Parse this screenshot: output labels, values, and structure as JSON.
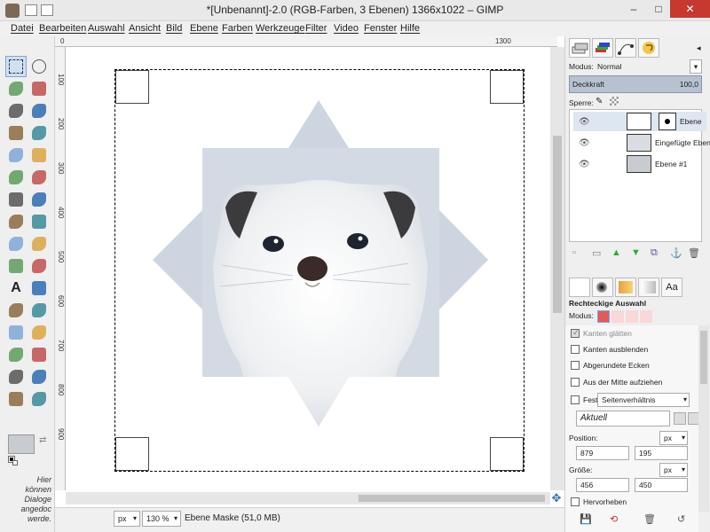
{
  "window": {
    "title": "*[Unbenannt]-2.0 (RGB-Farben, 3 Ebenen) 1366x1022 – GIMP",
    "minimize": "–",
    "maximize": "□",
    "close": "✕"
  },
  "menu": [
    "Datei",
    "Bearbeiten",
    "Auswahl",
    "Ansicht",
    "Bild",
    "Ebene",
    "Farben",
    "Werkzeuge",
    "Filter",
    "Video",
    "Fenster",
    "Hilfe"
  ],
  "toolbox": {
    "tools": [
      "rect-select-icon",
      "ellipse-select-icon",
      "lasso-icon",
      "magic-wand-icon",
      "select-by-color-icon",
      "scissors-icon",
      "foreground-select-icon",
      "paths-icon",
      "color-picker-icon",
      "zoom-icon",
      "measure-icon",
      "move-icon",
      "align-icon",
      "crop-icon",
      "rotate-icon",
      "scale-icon",
      "shear-icon",
      "perspective-icon",
      "flip-icon",
      "cage-icon",
      "text-icon",
      "bucket-fill-icon",
      "gradient-icon",
      "pencil-icon",
      "paintbrush-icon",
      "eraser-icon",
      "airbrush-icon",
      "ink-icon",
      "clone-icon",
      "heal-icon",
      "smudge-icon",
      "dodge-burn-icon"
    ],
    "hint": [
      "Hier",
      "können",
      "Dialoge",
      "angedoc",
      "werde."
    ]
  },
  "rulers": {
    "top": [
      "0",
      "1300"
    ],
    "left": [
      "100",
      "200",
      "300",
      "400",
      "500",
      "600",
      "700",
      "800",
      "900"
    ]
  },
  "statusbar": {
    "unit": "px",
    "zoom": "130 %",
    "message": "Ebene Maske (51,0 MB)"
  },
  "layers": {
    "mode_label": "Modus:",
    "mode_value": "Normal",
    "opacity_label": "Deckkraft",
    "opacity_value": "100,0",
    "lock_label": "Sperre:",
    "items": [
      {
        "name": "Ebene"
      },
      {
        "name": "Eingefügte Ebene"
      },
      {
        "name": "Ebene #1"
      }
    ]
  },
  "tool_options": {
    "title": "Rechteckige Auswahl",
    "mode_label": "Modus:",
    "options": [
      {
        "label": "Kanten glätten",
        "checked": true,
        "disabled": true
      },
      {
        "label": "Kanten ausblenden",
        "checked": false
      },
      {
        "label": "Abgerundete Ecken",
        "checked": false
      },
      {
        "label": "Aus der Mitte aufziehen",
        "checked": false
      }
    ],
    "fixed_label": "Fest:",
    "fixed_value": "Seitenverhältnis",
    "current": "Aktuell",
    "position_label": "Position:",
    "position_unit": "px",
    "position_x": "879",
    "position_y": "195",
    "size_label": "Größe:",
    "size_unit": "px",
    "size_w": "456",
    "size_h": "450",
    "highlight_label": "Hervorheben"
  },
  "colors": {
    "accent": "#7fa7d6",
    "close_button": "#c7392f",
    "foreground": "#c8cbd0",
    "opacity_bar": "#b7c2d1"
  }
}
